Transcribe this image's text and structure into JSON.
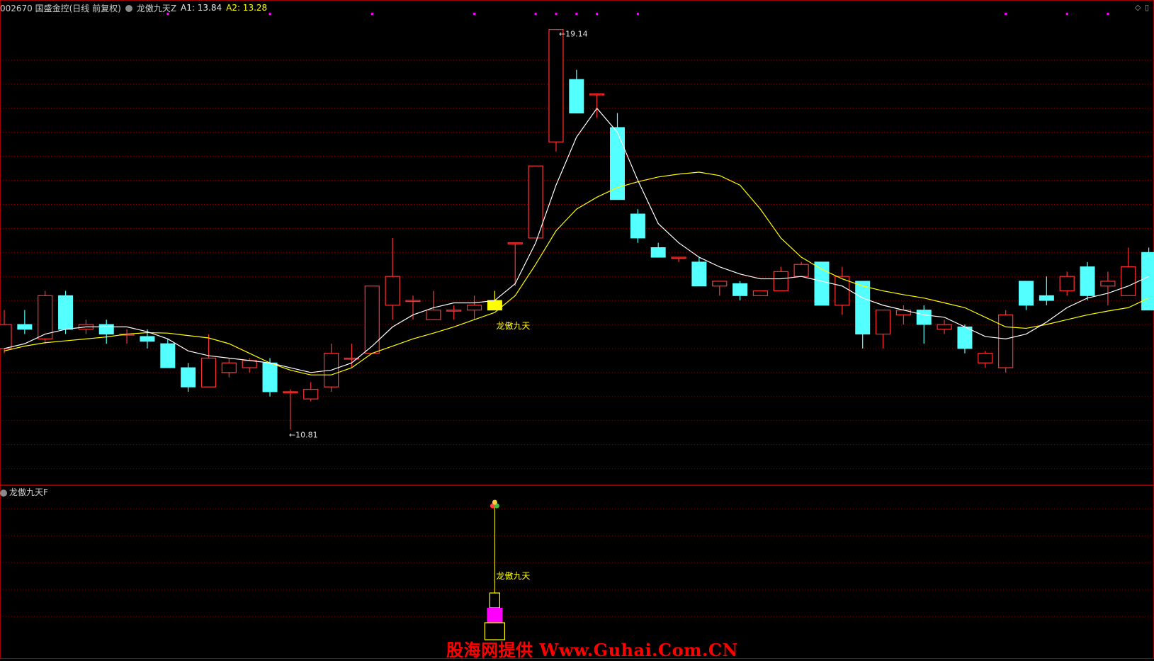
{
  "header": {
    "stock": "002670 国盛金控(日线 前复权)",
    "indicator": "龙傲九天Z",
    "a1_label": "A1: 13.84",
    "a2_label": "A2: 13.28",
    "sub_indicator": "龙傲九天F"
  },
  "watermark": "股海网提供 Www.Guhai.Com.CN",
  "colors": {
    "up": "#ff3232",
    "down": "#54ffff",
    "ma1": "#ffffff",
    "ma2": "#ffff00",
    "signal": "#ffff00",
    "grid": "#8b0000",
    "bar": "#ff00ff"
  },
  "chart_data": {
    "type": "candlestick",
    "ylim": [
      9.8,
      19.4
    ],
    "max_label": "19.14",
    "min_label": "10.81",
    "signal_label": "龙傲九天",
    "signal_index": 24,
    "candles": [
      [
        12.5,
        13.0,
        13.3,
        12.4
      ],
      [
        13.0,
        12.9,
        13.3,
        12.8
      ],
      [
        12.7,
        13.6,
        13.7,
        12.6
      ],
      [
        13.6,
        12.9,
        13.7,
        12.8
      ],
      [
        12.9,
        13.0,
        13.1,
        12.8
      ],
      [
        13.0,
        12.8,
        13.1,
        12.6
      ],
      [
        12.8,
        12.8,
        12.9,
        12.6
      ],
      [
        12.75,
        12.65,
        12.9,
        12.5
      ],
      [
        12.6,
        12.1,
        12.7,
        12.1
      ],
      [
        12.1,
        11.7,
        12.2,
        11.6
      ],
      [
        11.7,
        12.3,
        12.8,
        11.7
      ],
      [
        12.0,
        12.2,
        12.3,
        11.9
      ],
      [
        12.1,
        12.25,
        12.3,
        12.0
      ],
      [
        12.2,
        11.6,
        12.3,
        11.5
      ],
      [
        11.6,
        11.6,
        11.65,
        10.81
      ],
      [
        11.45,
        11.65,
        11.8,
        11.4
      ],
      [
        11.7,
        12.4,
        12.6,
        11.6
      ],
      [
        12.3,
        12.3,
        12.6,
        12.1
      ],
      [
        12.4,
        13.8,
        13.8,
        12.4
      ],
      [
        13.4,
        14.0,
        14.8,
        13.1
      ],
      [
        13.5,
        13.5,
        13.6,
        13.1
      ],
      [
        13.1,
        13.3,
        13.7,
        13.1
      ],
      [
        13.3,
        13.3,
        13.4,
        13.1
      ],
      [
        13.3,
        13.4,
        13.6,
        13.1
      ],
      [
        13.5,
        13.3,
        13.7,
        13.3
      ],
      [
        14.7,
        14.7,
        14.7,
        13.8
      ],
      [
        14.8,
        16.3,
        16.3,
        14.8
      ],
      [
        16.8,
        19.14,
        19.14,
        16.6
      ],
      [
        18.1,
        17.4,
        18.3,
        17.4
      ],
      [
        17.8,
        17.8,
        17.8,
        17.3
      ],
      [
        17.1,
        15.6,
        17.4,
        15.6
      ],
      [
        15.3,
        14.8,
        15.4,
        14.7
      ],
      [
        14.6,
        14.4,
        14.7,
        14.4
      ],
      [
        14.4,
        14.4,
        14.4,
        14.3
      ],
      [
        14.3,
        13.8,
        14.4,
        13.8
      ],
      [
        13.8,
        13.9,
        13.9,
        13.6
      ],
      [
        13.85,
        13.6,
        13.9,
        13.5
      ],
      [
        13.6,
        13.7,
        13.7,
        13.6
      ],
      [
        13.7,
        14.1,
        14.2,
        13.7
      ],
      [
        14.0,
        14.25,
        14.3,
        14.0
      ],
      [
        14.3,
        13.4,
        14.3,
        13.4
      ],
      [
        13.4,
        14.0,
        14.2,
        13.2
      ],
      [
        13.9,
        12.8,
        13.9,
        12.5
      ],
      [
        12.8,
        13.3,
        13.3,
        12.5
      ],
      [
        13.2,
        13.3,
        13.4,
        13.0
      ],
      [
        13.3,
        13.0,
        13.4,
        12.6
      ],
      [
        12.9,
        13.0,
        13.1,
        12.8
      ],
      [
        12.95,
        12.5,
        13.0,
        12.4
      ],
      [
        12.2,
        12.4,
        12.45,
        12.1
      ],
      [
        12.1,
        13.2,
        13.3,
        12.0
      ],
      [
        13.9,
        13.4,
        13.9,
        13.3
      ],
      [
        13.6,
        13.5,
        14.0,
        13.4
      ],
      [
        13.7,
        14.0,
        14.1,
        13.6
      ],
      [
        14.2,
        13.6,
        14.3,
        13.5
      ],
      [
        13.8,
        13.9,
        14.1,
        13.4
      ],
      [
        13.6,
        14.2,
        14.6,
        13.6
      ],
      [
        14.5,
        13.3,
        14.6,
        13.3
      ]
    ],
    "ma1": [
      12.5,
      12.6,
      12.8,
      12.9,
      12.95,
      12.95,
      12.95,
      12.85,
      12.7,
      12.45,
      12.35,
      12.3,
      12.25,
      12.2,
      12.1,
      12.0,
      12.05,
      12.2,
      12.55,
      12.95,
      13.2,
      13.35,
      13.45,
      13.45,
      13.5,
      13.85,
      14.7,
      15.9,
      16.9,
      17.5,
      17.0,
      16.0,
      15.1,
      14.7,
      14.4,
      14.2,
      14.05,
      13.95,
      13.95,
      14.0,
      13.9,
      13.8,
      13.55,
      13.4,
      13.3,
      13.2,
      13.15,
      12.95,
      12.75,
      12.7,
      12.8,
      13.05,
      13.35,
      13.55,
      13.65,
      13.8,
      14.0
    ],
    "ma2": [
      12.45,
      12.55,
      12.62,
      12.66,
      12.7,
      12.74,
      12.8,
      12.83,
      12.82,
      12.77,
      12.72,
      12.6,
      12.4,
      12.2,
      12.05,
      11.95,
      11.95,
      12.1,
      12.4,
      12.55,
      12.7,
      12.82,
      12.95,
      13.1,
      13.25,
      13.6,
      14.25,
      14.95,
      15.4,
      15.65,
      15.85,
      15.97,
      16.07,
      16.13,
      16.17,
      16.1,
      15.9,
      15.4,
      14.8,
      14.4,
      14.15,
      13.95,
      13.8,
      13.7,
      13.62,
      13.55,
      13.45,
      13.35,
      13.15,
      12.95,
      12.92,
      13.0,
      13.1,
      13.2,
      13.28,
      13.35,
      13.55
    ],
    "top_markers": [
      8,
      13,
      18,
      23,
      26,
      27,
      28,
      29,
      31,
      49,
      52,
      54
    ]
  }
}
